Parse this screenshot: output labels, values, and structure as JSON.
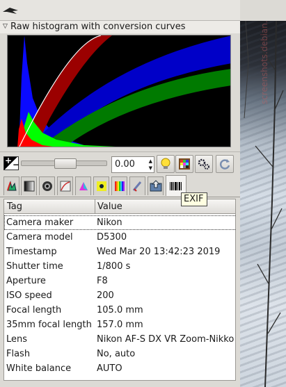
{
  "histogram": {
    "title": "Raw histogram with conversion curves"
  },
  "controls": {
    "exposure_value": "0.00"
  },
  "tooltip": {
    "text": "EXIF"
  },
  "exif_table": {
    "headers": [
      "Tag",
      "Value"
    ],
    "rows": [
      {
        "tag": "Camera maker",
        "value": "Nikon"
      },
      {
        "tag": "Camera model",
        "value": "D5300"
      },
      {
        "tag": "Timestamp",
        "value": "Wed Mar 20 13:42:23 2019"
      },
      {
        "tag": "Shutter time",
        "value": "1/800 s"
      },
      {
        "tag": "Aperture",
        "value": "F8"
      },
      {
        "tag": "ISO speed",
        "value": "200"
      },
      {
        "tag": "Focal length",
        "value": "105.0 mm"
      },
      {
        "tag": "35mm focal length",
        "value": "157.0 mm"
      },
      {
        "tag": "Lens",
        "value": "Nikon AF-S DX VR Zoom-Nikko"
      },
      {
        "tag": "Flash",
        "value": "No, auto"
      },
      {
        "tag": "White balance",
        "value": "AUTO"
      }
    ]
  },
  "icons": {
    "app_logo": "ufraw-logo-icon",
    "expander": "triangle-down-icon",
    "exposure": "exposure-icon",
    "auto_exposure": "lightbulb-icon",
    "color_check": "color-grid-icon",
    "settings": "gears-icon",
    "reset": "refresh-icon"
  },
  "photo": {
    "watermark": "screenshots.debian.net"
  },
  "colors": {
    "histogram_red": "#ff0000",
    "histogram_green": "#00ff00",
    "histogram_blue": "#0000ff",
    "tooltip_bg": "#ffffe1"
  }
}
